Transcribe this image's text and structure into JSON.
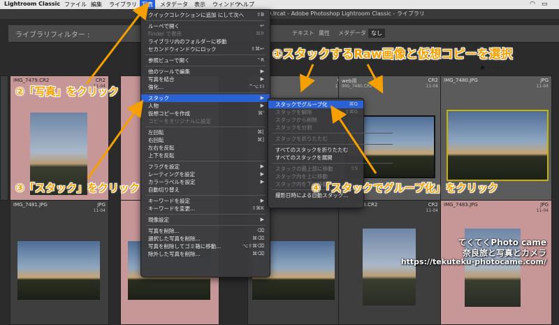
{
  "menubar": {
    "app": "Lightroom Classic",
    "items": [
      "ファイル",
      "編集",
      "ライブラリ",
      "写真",
      "メタデータ",
      "表示",
      "ウィンドウ",
      "ヘルプ"
    ],
    "active_index": 3
  },
  "window_title": "2013_2014-2-v10.lrcat - Adobe Photoshop Lightroom Classic - ライブラリ",
  "filter_bar": {
    "label": "ライブラリフィルター :",
    "buttons": [
      "テキスト",
      "属性",
      "メタデータ",
      "なし"
    ],
    "active": "なし"
  },
  "grid": {
    "cells": [
      {
        "filename": "IMG_7479.CR2",
        "type": "CR2",
        "date": "11-04"
      },
      {
        "filename": "",
        "type": "",
        "date": ""
      },
      {
        "filename": "",
        "type": "CR2",
        "date": "11-04"
      },
      {
        "filename": "web用",
        "subname": "IMG_7480.CR2",
        "type": "CR2",
        "date": "11-04"
      },
      {
        "filename": "IMG_7480.JPG",
        "type": "JPG",
        "date": "11-04"
      },
      {
        "filename": "IMG_7481.JPG",
        "type": "JPG",
        "date": "11-04"
      },
      {
        "filename": "",
        "type": "",
        "date": ""
      },
      {
        "filename": "",
        "type": "",
        "date": ""
      },
      {
        "filename": "IMG_7483.CR2",
        "type": "CR2",
        "date": "11-04"
      },
      {
        "filename": "IMG_7483.JPG",
        "type": "JPG",
        "date": "11-04"
      }
    ]
  },
  "photo_menu": {
    "items": [
      {
        "label": "クイックコレクションに追加 にして次へ",
        "shortcut": "⇧B"
      },
      {
        "sep": true
      },
      {
        "label": "ルーペで開く",
        "shortcut": "↩"
      },
      {
        "label": "Finder で表示",
        "shortcut": "⌘R",
        "disabled": true
      },
      {
        "label": "ライブラリ内のフォルダーに移動",
        "shortcut": ""
      },
      {
        "label": "セカンドウィンドウにロック",
        "shortcut": "⇧⌘↩"
      },
      {
        "sep": true
      },
      {
        "label": "参照ビューで開く",
        "shortcut": "⌃R"
      },
      {
        "sep": true
      },
      {
        "label": "他のツールで編集",
        "shortcut": "▶"
      },
      {
        "label": "写真を結合",
        "shortcut": "▶"
      },
      {
        "label": "強化...",
        "shortcut": "^⌥⇧I"
      },
      {
        "sep": true
      },
      {
        "label": "スタック",
        "shortcut": "▶",
        "highlight": true
      },
      {
        "label": "人物",
        "shortcut": "▶"
      },
      {
        "label": "仮想コピーを作成",
        "shortcut": "⌘'"
      },
      {
        "label": "コピーをオリジナルに設定",
        "shortcut": "",
        "disabled": true
      },
      {
        "sep": true
      },
      {
        "label": "左回転",
        "shortcut": "⌘["
      },
      {
        "label": "右回転",
        "shortcut": "⌘]"
      },
      {
        "label": "左右を反転",
        "shortcut": ""
      },
      {
        "label": "上下を反転",
        "shortcut": ""
      },
      {
        "sep": true
      },
      {
        "label": "フラグを設定",
        "shortcut": "▶"
      },
      {
        "label": "レーティングを設定",
        "shortcut": "▶"
      },
      {
        "label": "カラーラベルを設定",
        "shortcut": "▶"
      },
      {
        "label": "自動切り替え",
        "shortcut": ""
      },
      {
        "sep": true
      },
      {
        "label": "キーワードを設定",
        "shortcut": "▶"
      },
      {
        "label": "キーワードを変更...",
        "shortcut": "⇧⌘K"
      },
      {
        "sep": true
      },
      {
        "label": "現像設定",
        "shortcut": "▶"
      },
      {
        "sep": true
      },
      {
        "label": "写真を削除...",
        "shortcut": "⌫"
      },
      {
        "label": "選択した写真を削除...",
        "shortcut": "⌘⌫"
      },
      {
        "label": "写真を削除してゴミ箱に移動...",
        "shortcut": "⌥⇧⌘⌫"
      },
      {
        "label": "除外した写真を削除...",
        "shortcut": "⌘⌫"
      }
    ]
  },
  "stack_submenu": {
    "items": [
      {
        "label": "スタックでグループ化",
        "shortcut": "⌘G",
        "highlight": true
      },
      {
        "label": "スタックを解除",
        "shortcut": "⇧⌘G",
        "disabled": true
      },
      {
        "label": "スタックから削除",
        "shortcut": "",
        "disabled": true
      },
      {
        "label": "スタックを分割",
        "shortcut": "",
        "disabled": true
      },
      {
        "sep": true
      },
      {
        "label": "スタックを折りたたむ",
        "shortcut": "",
        "disabled": true
      },
      {
        "sep": true
      },
      {
        "label": "すべてのスタックを折りたたむ",
        "shortcut": ""
      },
      {
        "label": "すべてのスタックを展開",
        "shortcut": ""
      },
      {
        "sep": true
      },
      {
        "label": "スタックの最上部に移動",
        "shortcut": "⇧S",
        "disabled": true
      },
      {
        "label": "スタック内を上に移動",
        "shortcut": "",
        "disabled": true
      },
      {
        "label": "スタック内を下に移動",
        "shortcut": "",
        "disabled": true
      },
      {
        "sep": true
      },
      {
        "label": "撮影日時による自動スタック...",
        "shortcut": ""
      }
    ]
  },
  "annotations": {
    "a1": "①スタックするRaw画像と仮想コピーを選択",
    "a2": "②「写真」をクリック",
    "a3": "③「スタック」をクリック",
    "a4": "④「スタックでグループ化」をクリック",
    "color": "#f5a000"
  },
  "watermark": {
    "line1": "てくてくPhoto came",
    "line2": "奈良旅と写真とカメラ",
    "line3": "https://tekuteku-photocame.com/"
  }
}
